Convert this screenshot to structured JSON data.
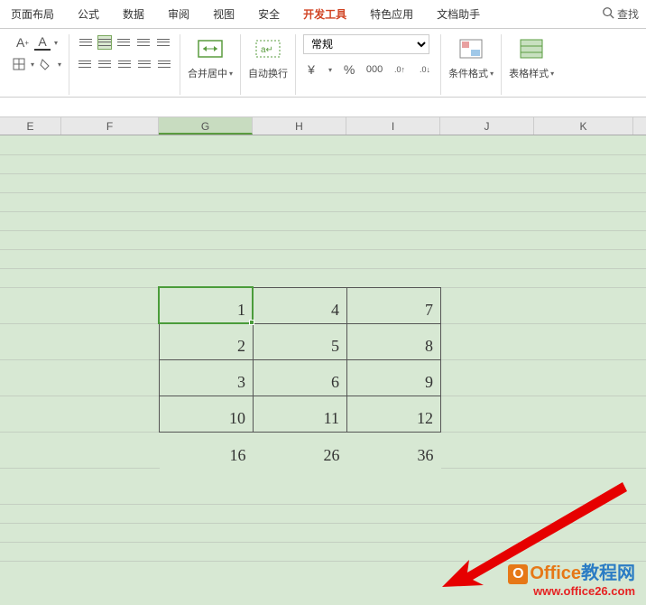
{
  "tabs": [
    "页面布局",
    "公式",
    "数据",
    "审阅",
    "视图",
    "安全",
    "开发工具",
    "特色应用",
    "文档助手"
  ],
  "active_tab_index": 6,
  "search_label": "查找",
  "toolbar": {
    "merge_label": "合并居中",
    "wrap_label": "自动换行",
    "format_value": "常规",
    "cond_format_label": "条件格式",
    "table_style_label": "表格样式"
  },
  "columns": [
    "E",
    "F",
    "G",
    "H",
    "I",
    "J",
    "K"
  ],
  "selected_col": "G",
  "table": {
    "rows": [
      [
        1,
        4,
        7
      ],
      [
        2,
        5,
        8
      ],
      [
        3,
        6,
        9
      ],
      [
        10,
        11,
        12
      ]
    ],
    "sums": [
      16,
      26,
      36
    ]
  },
  "watermark": {
    "brand": "Office",
    "suffix": "教程网",
    "url": "www.office26.com",
    "logo": "O"
  }
}
